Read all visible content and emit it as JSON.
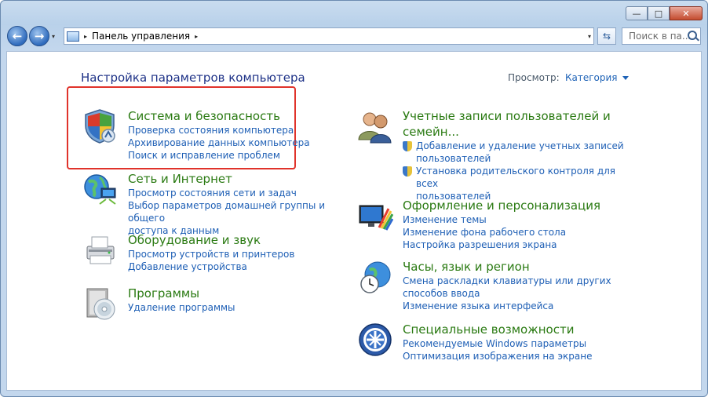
{
  "window": {
    "minimize_label": "—",
    "maximize_label": "□",
    "close_label": "✕"
  },
  "nav": {
    "back_label": "←",
    "forward_label": "→",
    "history_label": "▾"
  },
  "address": {
    "breadcrumb_sep": "▸",
    "location": "Панель управления",
    "trailing_sep": "▸",
    "dropdown": "▾"
  },
  "refresh_label": "⇆",
  "search": {
    "placeholder": "Поиск в па..."
  },
  "main": {
    "title": "Настройка параметров компьютера",
    "view_label": "Просмотр:",
    "view_value": "Категория"
  },
  "categories_left": [
    {
      "title": "Система и безопасность",
      "icon": "shield-icon",
      "links": [
        "Проверка состояния компьютера",
        "Архивирование данных компьютера",
        "Поиск и исправление проблем"
      ]
    },
    {
      "title": "Сеть и Интернет",
      "icon": "network-globe-icon",
      "links": [
        "Просмотр состояния сети и задач",
        "Выбор параметров домашней группы и общего",
        "доступа к данным"
      ]
    },
    {
      "title": "Оборудование и звук",
      "icon": "printer-icon",
      "links": [
        "Просмотр устройств и принтеров",
        "Добавление устройства"
      ]
    },
    {
      "title": "Программы",
      "icon": "programs-disc-icon",
      "links": [
        "Удаление программы"
      ]
    }
  ],
  "categories_right": [
    {
      "title_line1": "Учетные записи пользователей и",
      "title_line2": "семейн...",
      "icon": "users-icon",
      "links": [
        "Добавление и удаление учетных записей",
        "пользователей",
        "Установка родительского контроля для всех",
        "пользователей"
      ]
    },
    {
      "title": "Оформление и персонализация",
      "icon": "monitor-palette-icon",
      "links": [
        "Изменение темы",
        "Изменение фона рабочего стола",
        "Настройка разрешения экрана"
      ]
    },
    {
      "title": "Часы, язык и регион",
      "icon": "clock-globe-icon",
      "links": [
        "Смена раскладки клавиатуры или других",
        "способов ввода",
        "Изменение языка интерфейса"
      ]
    },
    {
      "title": "Специальные возможности",
      "icon": "accessibility-icon",
      "links": [
        "Рекомендуемые Windows параметры",
        "Оптимизация изображения на экране"
      ]
    }
  ]
}
